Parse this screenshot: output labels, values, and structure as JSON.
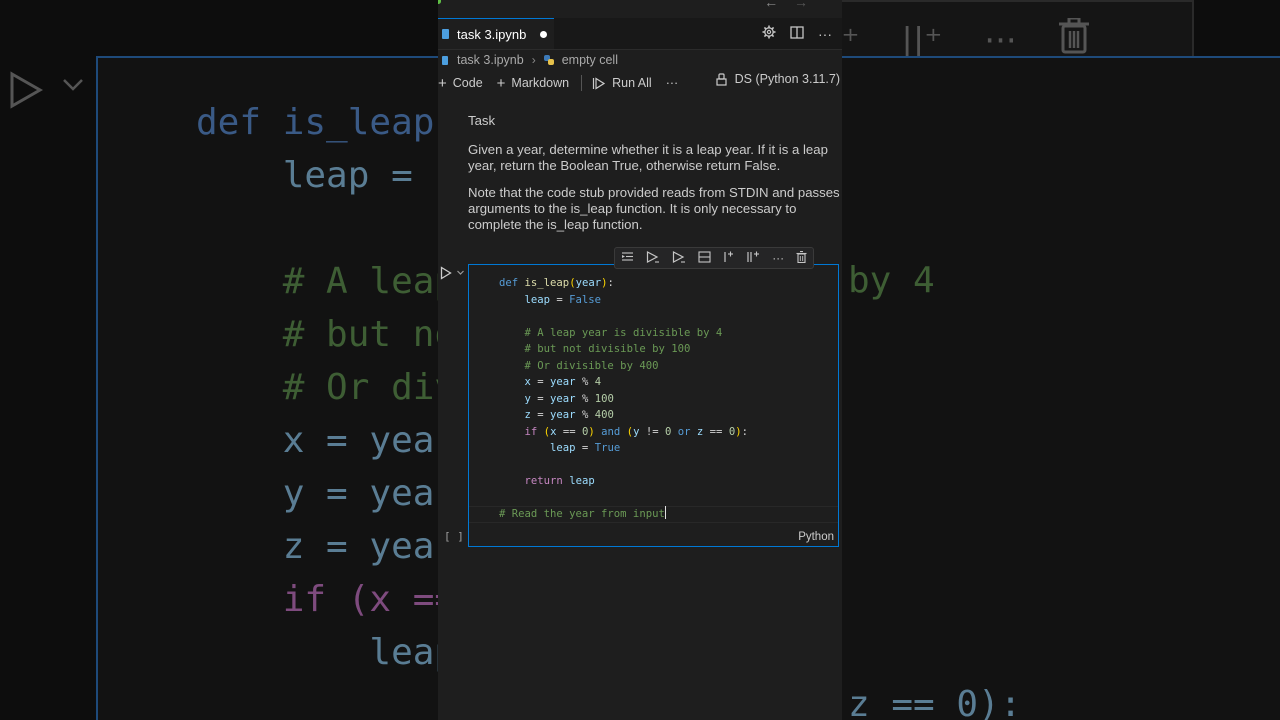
{
  "background": {
    "code_lines": [
      "def is_leap(",
      "    leap = F",
      "",
      "    # A leap",
      "    # but no",
      "    # Or div",
      "    x = year",
      "    y = year",
      "    z = year",
      "    if (x ==",
      "        leap"
    ],
    "right_fragments": [
      "by 4",
      "z == 0):"
    ]
  },
  "window": {
    "nav_back": "←",
    "nav_forward": "→"
  },
  "tab": {
    "title": "task 3.ipynb",
    "dirty_indicator": "●"
  },
  "breadcrumb": {
    "file": "task 3.ipynb",
    "separator": "›",
    "cell": "empty cell"
  },
  "notebook_toolbar": {
    "add_code": "Code",
    "add_markdown": "Markdown",
    "run_all": "Run All",
    "more": "···",
    "kernel": "DS (Python 3.11.7)"
  },
  "markdown_cell": {
    "heading": "Task",
    "paragraph1": "Given a year, determine whether it is a leap year. If it is a leap year, return the Boolean True, otherwise return False.",
    "paragraph2": "Note that the code stub provided reads from STDIN and passes arguments to the is_leap function. It is only necessary to complete the is_leap function."
  },
  "code_cell": {
    "execution_count": "[ ]",
    "language": "Python",
    "last_line": "# Read the year from input"
  },
  "colors": {
    "accent": "#0078d4",
    "editor_bg": "#1e1e1e",
    "keyword": "#569cd6",
    "function": "#dcdcaa",
    "comment": "#6a9955",
    "number": "#b5cea8"
  }
}
